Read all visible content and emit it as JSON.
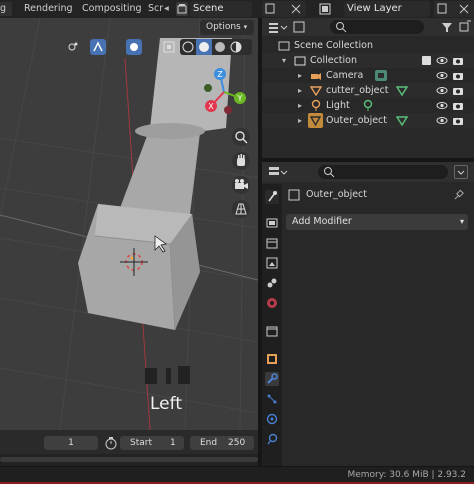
{
  "topbar": {
    "tabs": [
      "Rendering",
      "Compositing",
      "Scr"
    ],
    "scene_label": "Scene",
    "view_layer_label": "View Layer",
    "arrow_left": "◂"
  },
  "viewport": {
    "options_label": "Options",
    "view_label": "Left",
    "gizmo_axes": {
      "z": "Z",
      "y": "Y",
      "x": "X"
    }
  },
  "timeline": {
    "current_frame": "1",
    "start_label": "Start",
    "start_value": "1",
    "end_label": "End",
    "end_value": "250"
  },
  "outliner": {
    "search_placeholder": "",
    "root": "Scene Collection",
    "collection": "Collection",
    "items": [
      {
        "name": "Camera",
        "type": "camera"
      },
      {
        "name": "cutter_object",
        "type": "mesh"
      },
      {
        "name": "Light",
        "type": "light"
      },
      {
        "name": "Outer_object",
        "type": "mesh"
      }
    ]
  },
  "properties": {
    "search_placeholder": "",
    "object_name": "Outer_object",
    "add_modifier_label": "Add Modifier"
  },
  "status": {
    "memory_text": "Memory: 30.6 MiB | 2.93.2"
  },
  "colors": {
    "accent_blue": "#4772b3",
    "x_axis": "#e0374f",
    "y_axis": "#6cb824",
    "z_axis": "#3b8ee0",
    "wrench_active": "#4a7fd1"
  }
}
